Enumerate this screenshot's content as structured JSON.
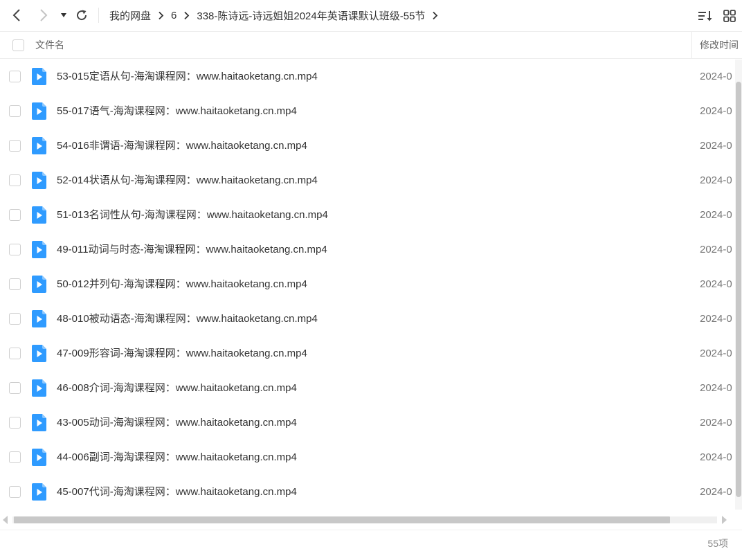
{
  "breadcrumb": {
    "items": [
      "我的网盘",
      "6",
      "338-陈诗远-诗远姐姐2024年英语课默认班级-55节"
    ]
  },
  "header": {
    "name_col": "文件名",
    "mtime_col": "修改时间"
  },
  "files": [
    {
      "name": "53-015定语从句-海淘课程网：www.haitaoketang.cn.mp4",
      "mtime": "2024-0"
    },
    {
      "name": "55-017语气-海淘课程网：www.haitaoketang.cn.mp4",
      "mtime": "2024-0"
    },
    {
      "name": "54-016非谓语-海淘课程网：www.haitaoketang.cn.mp4",
      "mtime": "2024-0"
    },
    {
      "name": "52-014状语从句-海淘课程网：www.haitaoketang.cn.mp4",
      "mtime": "2024-0"
    },
    {
      "name": "51-013名词性从句-海淘课程网：www.haitaoketang.cn.mp4",
      "mtime": "2024-0"
    },
    {
      "name": "49-011动词与时态-海淘课程网：www.haitaoketang.cn.mp4",
      "mtime": "2024-0"
    },
    {
      "name": "50-012并列句-海淘课程网：www.haitaoketang.cn.mp4",
      "mtime": "2024-0"
    },
    {
      "name": "48-010被动语态-海淘课程网：www.haitaoketang.cn.mp4",
      "mtime": "2024-0"
    },
    {
      "name": "47-009形容词-海淘课程网：www.haitaoketang.cn.mp4",
      "mtime": "2024-0"
    },
    {
      "name": "46-008介词-海淘课程网：www.haitaoketang.cn.mp4",
      "mtime": "2024-0"
    },
    {
      "name": "43-005动词-海淘课程网：www.haitaoketang.cn.mp4",
      "mtime": "2024-0"
    },
    {
      "name": "44-006副词-海淘课程网：www.haitaoketang.cn.mp4",
      "mtime": "2024-0"
    },
    {
      "name": "45-007代词-海淘课程网：www.haitaoketang.cn.mp4",
      "mtime": "2024-0"
    }
  ],
  "footer": {
    "count": "55项"
  },
  "icons": {
    "back": "chevron-left-icon",
    "forward": "chevron-right-icon",
    "history": "caret-down-icon",
    "refresh": "refresh-icon",
    "sort": "sort-icon",
    "view": "grid-view-icon",
    "file": "video-file-icon"
  },
  "colors": {
    "video_icon": "#2f9bff"
  }
}
